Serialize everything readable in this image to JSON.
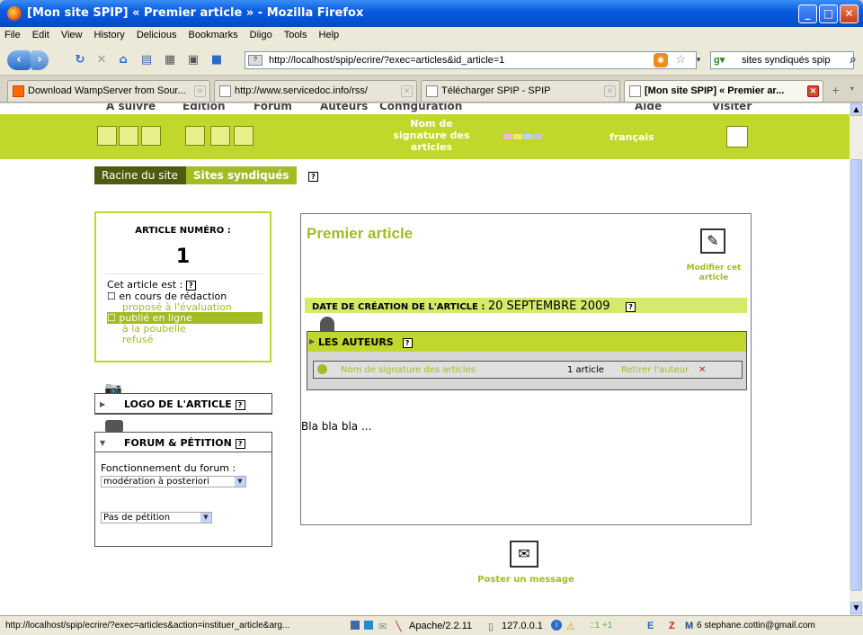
{
  "window": {
    "title": "[Mon site SPIP] « Premier article » - Mozilla Firefox"
  },
  "menu": [
    "File",
    "Edit",
    "View",
    "History",
    "Delicious",
    "Bookmarks",
    "Diigo",
    "Tools",
    "Help"
  ],
  "toolbar": {
    "url": "http://localhost/spip/ecrire/?exec=articles&id_article=1",
    "search_value": "sites syndiqués spip"
  },
  "tabs": [
    {
      "label": "Download WampServer from Sour..."
    },
    {
      "label": "http://www.servicedoc.info/rss/"
    },
    {
      "label": "Télécharger SPIP - SPIP"
    },
    {
      "label": "[Mon site SPIP] « Premier ar..."
    }
  ],
  "spip": {
    "top_menu": [
      "A suivre",
      "Edition",
      "Forum",
      "Auteurs",
      "Configuration",
      "Aide",
      "Visiter"
    ],
    "signature_title": "Nom de signature des articles",
    "language": "français",
    "breadcrumb": [
      "Racine du site",
      "Sites syndiqués"
    ],
    "help_mark": "?",
    "article_number_label": "ARTICLE NUMÉRO :",
    "article_number": "1",
    "status_label": "Cet article est :",
    "status_options": [
      "☐ en cours de rédaction",
      "proposé à l'évaluation",
      "☐ publié en ligne",
      "à la poubelle",
      "refusé"
    ],
    "logo_label": "LOGO DE L'ARTICLE",
    "forum_label": "FORUM & PÉTITION",
    "forum_mode_label": "Fonctionnement du forum :",
    "forum_mode_value": "modération à posteriori",
    "petition_value": "Pas de pétition",
    "article_title": "Premier article",
    "edit_label": "Modifier cet article",
    "date_label": "DATE DE CRÉATION DE L'ARTICLE :",
    "date_value": "20 SEPTEMBRE 2009",
    "authors_label": "LES AUTEURS",
    "author_name": "Nom de signature des articles",
    "author_count": "1 article",
    "remove_author": "Retirer l'auteur",
    "body_text": "Bla bla bla ...",
    "post_label": "Poster un message",
    "colors": {
      "green": "#c2d72c",
      "dark_green": "#4e5c10",
      "text_green": "#a4bb24"
    }
  },
  "statusbar": {
    "url": "http://localhost/spip/ecrire/?exec=articles&action=instituer_article&arg...",
    "server": "Apache/2.2.11",
    "ip": "127.0.0.1",
    "counter": "::1 +1",
    "mail": "6 stephane.cottin@gmail.com"
  }
}
